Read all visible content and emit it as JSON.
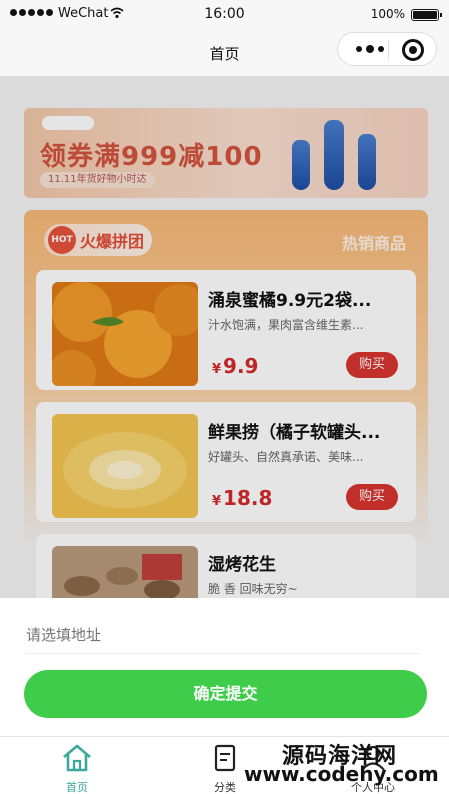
{
  "status_bar": {
    "carrier": "WeChat",
    "time": "16:00",
    "battery": "100%"
  },
  "navbar": {
    "title": "首页"
  },
  "banner": {
    "promo_text": "领券满999减100",
    "sub_text": "11.11年货好物小时达"
  },
  "hot_section": {
    "tag": "HOT",
    "title": "火爆拼团",
    "right_label": "热销商品",
    "products": [
      {
        "name": "涌泉蜜橘9.9元2袋...",
        "desc": "汁水饱满，果肉富含维生素...",
        "currency": "¥",
        "price": "9.9",
        "buy_label": "购买"
      },
      {
        "name": "鲜果捞（橘子软罐头...",
        "desc": "好罐头、自然真承诺、美味...",
        "currency": "¥",
        "price": "18.8",
        "buy_label": "购买"
      },
      {
        "name": "湿烤花生",
        "desc": "脆 香 回味无穷~"
      }
    ]
  },
  "sheet": {
    "address_placeholder": "请选填地址",
    "confirm_label": "确定提交"
  },
  "tabbar": {
    "items": [
      {
        "label": "首页",
        "icon": "home-icon",
        "active": true
      },
      {
        "label": "分类",
        "icon": "category-icon",
        "active": false
      },
      {
        "label": "个人中心",
        "icon": "profile-icon",
        "active": false
      }
    ],
    "active_color": "#3aa89a"
  },
  "watermark": {
    "line1": "源码海洋网",
    "line2": "www.codehy.com"
  },
  "colors": {
    "accent_green": "#3fcc4a",
    "price_red": "#d42b2b",
    "buy_red": "#d9352f",
    "hot_orange": "#e24e38"
  }
}
